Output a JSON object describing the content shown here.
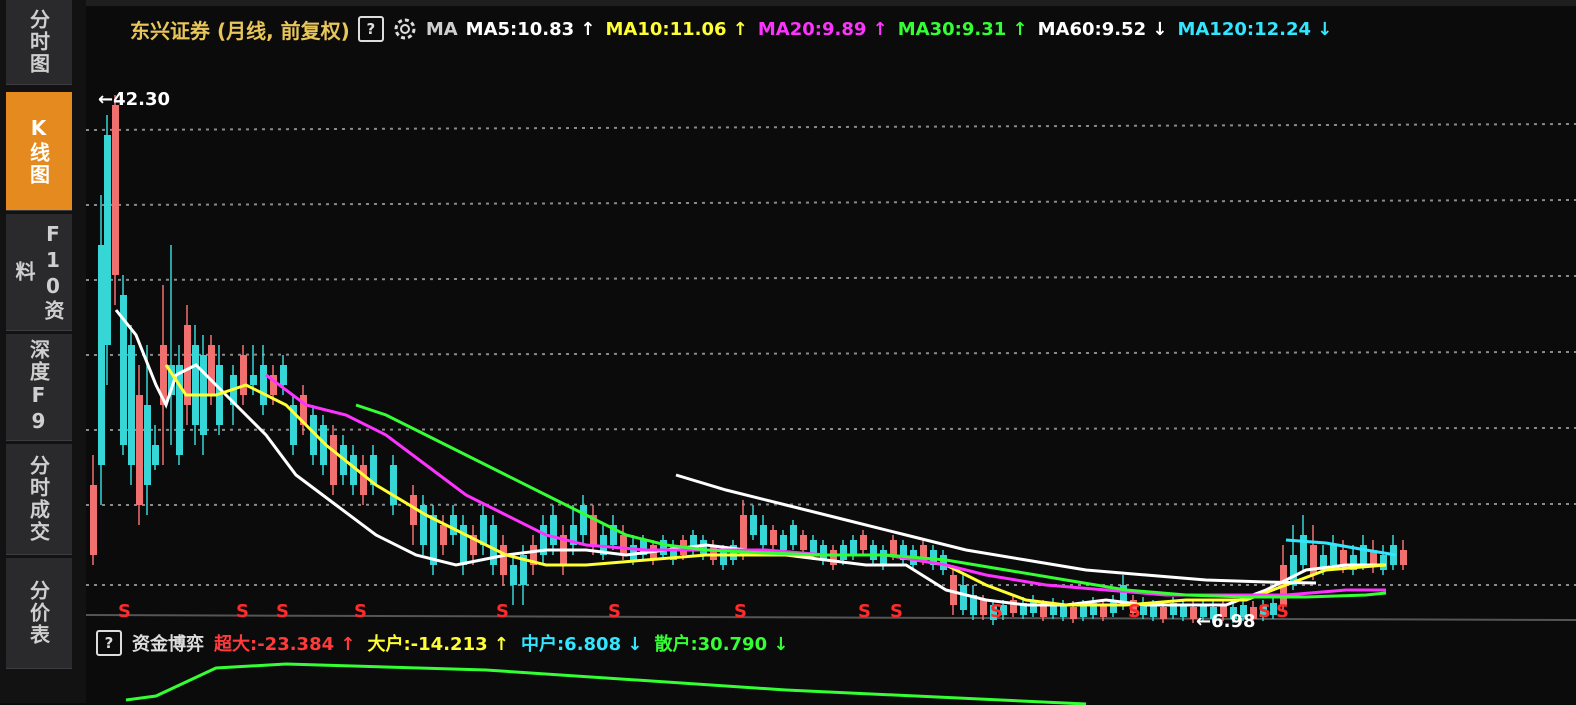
{
  "sidebar": {
    "tabs": [
      {
        "label": "分时图",
        "active": false
      },
      {
        "label": "K线图",
        "active": true
      },
      {
        "label": "F10资料",
        "active": false
      },
      {
        "label": "深度F9",
        "active": false
      },
      {
        "label": "分时成交",
        "active": false
      },
      {
        "label": "分价表",
        "active": false
      }
    ]
  },
  "header": {
    "title": "东兴证券 (月线, 前复权)",
    "help_icon": "?",
    "ma_label": "MA",
    "ma": [
      {
        "text": "MA5:10.83",
        "arrow": "↑",
        "color": "#ffffff"
      },
      {
        "text": "MA10:11.06",
        "arrow": "↑",
        "color": "#ffff33"
      },
      {
        "text": "MA20:9.89",
        "arrow": "↑",
        "color": "#ff33ff"
      },
      {
        "text": "MA30:9.31",
        "arrow": "↑",
        "color": "#33ff33"
      },
      {
        "text": "MA60:9.52",
        "arrow": "↓",
        "color": "#ffffff"
      },
      {
        "text": "MA120:12.24",
        "arrow": "↓",
        "color": "#33e6ff"
      }
    ]
  },
  "chart": {
    "high_label": "42.30",
    "low_label": "6.98",
    "signal_label": "S",
    "colors": {
      "up": "#f07070",
      "down": "#36d6d6",
      "grid": "#8a8a8a"
    }
  },
  "fund_panel": {
    "help_icon": "?",
    "title": "资金博弈",
    "items": [
      {
        "text": "超大:-23.384",
        "arrow": "↑",
        "color": "#ff3b3b"
      },
      {
        "text": "大户:-14.213",
        "arrow": "↑",
        "color": "#ffff33"
      },
      {
        "text": "中户:6.808",
        "arrow": "↓",
        "color": "#33e6ff"
      },
      {
        "text": "散户:30.790",
        "arrow": "↓",
        "color": "#33ff33"
      }
    ]
  }
}
